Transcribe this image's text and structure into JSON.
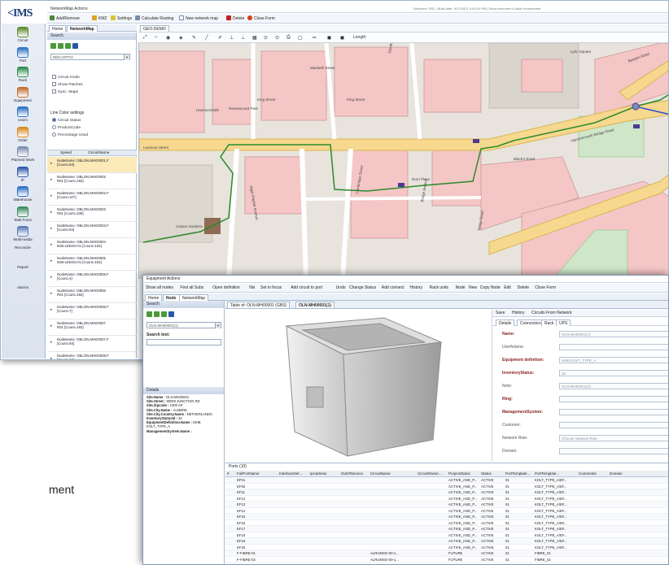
{
  "app": {
    "logo_text": "IMS",
    "menu_title": "NetworkMap Actions",
    "status_right": "Welcome: RSL   |   Build date: 9/17/2021 9:40:19 PM   |   Show welcome to Multi environment",
    "toolbar": [
      "Add/Remove",
      "KMZ",
      "Settings",
      "Calculate Routing",
      "New network map",
      "Delete",
      "Close Form"
    ]
  },
  "sidebar": {
    "items": [
      "Circuit",
      "Port",
      "Rack",
      "Equipment",
      "Users",
      "Order",
      "Planned Work",
      "IP",
      "Warehouse",
      "Task Force",
      "Multi-media",
      "Reconcile",
      "Report",
      "Alarms"
    ]
  },
  "left_tabs": [
    "Home",
    "NetworkMap"
  ],
  "search_panel": {
    "title": "Search",
    "combo_value": "RED-OPTIO",
    "checkboxes": [
      "Circuit mode",
      "Show Patches",
      "Sync. Maps"
    ],
    "line_color_title": "Line Color settings",
    "radios": [
      "Circuit Status",
      "ProductCode",
      "Percentage Used"
    ],
    "columns": [
      "Speed",
      "CircuitName"
    ],
    "items": [
      [
        "NodeName: OBLON.MHO0001.F",
        "[Count=84]"
      ],
      [
        "NodeName: OBLON.MHO0002",
        "R01 [Count=192]"
      ],
      [
        "NodeName: OBLON.MHO0002.F",
        "[Count=107]"
      ],
      [
        "NodeName: OBLON.MHO0003",
        "R01 [Count=108]"
      ],
      [
        "NodeName: OBLON.MHO0003.F",
        "[Count=84]"
      ],
      [
        "NodeName: OBLON.MHO0004",
        "M25-LEEDS-01 [Count=192]"
      ],
      [
        "NodeName: OBLON.MHO0005",
        "M25-LEEDS-01 [Count=192]"
      ],
      [
        "NodeName: OBLON.MHO0005.F",
        "[Count=4]"
      ],
      [
        "NodeName: OBLON.MHO0006",
        "R01 [Count=192]"
      ],
      [
        "NodeName: OBLON.MHO0006.F",
        "[Count=7]"
      ],
      [
        "NodeName: OBLON.MHO0007",
        "R01 [Count=192]"
      ],
      [
        "NodeName: OBLON.MHO0007.F",
        "[Count=84]"
      ],
      [
        "NodeName: OBLON.MHO0008.F",
        "[Count=84]"
      ]
    ]
  },
  "map": {
    "tab": "GEO-DEMO",
    "labels": [
      "Lyric Square",
      "King Street",
      "King Street",
      "Beadon Road",
      "Glenthorne Road",
      "Black's Road",
      "Hammersmith Bridge Road",
      "Ravenscourt Park",
      "Hammersmith",
      "Dorn Place",
      "Caxton Gardens",
      "Nigel Playfair Avenue",
      "Bridge Avenue",
      "Cambridge Grove",
      "Leamore Street",
      "Macbeth Street",
      "Weltje Road"
    ],
    "range_label": "Length:"
  },
  "equipment": {
    "title": "Equipment Actions",
    "toolbar": [
      "Show all nodes",
      "Find all Subs",
      "Open definition",
      "Nix",
      "Set in focus",
      "Add circuit to port",
      "Undo",
      "Change Status",
      "Add connect",
      "History",
      "Rack units",
      "Node",
      "New",
      "Copy Node",
      "Edit",
      "Delete",
      "Close Form"
    ],
    "tabs": [
      "Home",
      "Node",
      "NetworkMap"
    ],
    "search_title": "Search",
    "search_text_label": "Search text:",
    "combo_value": "OLN-MH00001(1)",
    "details_title": "Details",
    "details": [
      [
        "Site.Name",
        "OLN-MH00001"
      ],
      [
        "Site.Street",
        "90000 JUNCTION RD"
      ],
      [
        "Site.Zipcode",
        "1000 AP"
      ],
      [
        "Site.City.Name",
        "ALMERE"
      ],
      [
        "Site.City.Country.Name",
        "NETHERLANDS"
      ],
      [
        "InventoryStatusId",
        "32"
      ],
      [
        "EquipmentDefinition.Name",
        "MHB KOLT_TYPE_A"
      ],
      [
        "ManagementSystem.Name",
        ""
      ]
    ],
    "doc_tabs": [
      "Table of: OLN-MH00001 (GBS)",
      "OLN-MH00001(1)"
    ],
    "form_tabs": [
      "Save",
      "History",
      "Circuits From Network"
    ],
    "form_subtabs": [
      "Details",
      "Connectors",
      "Rack",
      "UPS"
    ],
    "fields": [
      {
        "label": "Name:",
        "value": "OLN-MH00001(1)",
        "req": true
      },
      {
        "label": "Userfelame:",
        "value": "",
        "req": false
      },
      {
        "label": "Equipment definition:",
        "value": "MHB KOLT_TYPE_A",
        "req": true
      },
      {
        "label": "InventoryStatus:",
        "value": "32",
        "req": true
      },
      {
        "label": "Note:",
        "value": "OLN-MH00001(1)",
        "req": false
      },
      {
        "label": "Ring:",
        "value": "",
        "req": true
      },
      {
        "label": "ManagementSystem:",
        "value": "",
        "req": true
      },
      {
        "label": "Customer:",
        "value": "",
        "req": false
      },
      {
        "label": "Network Role:",
        "value": "Choose Network Role",
        "req": false
      },
      {
        "label": "Domain:",
        "value": "",
        "req": false
      }
    ],
    "grid_title": "Ports (10)",
    "columns": [
      "#",
      "FullPortName",
      "InterfaceDef...",
      "IpAddress",
      "OutOfService",
      "CircuitName",
      "CircuitOwner...",
      "ProjectStatus",
      "Status",
      "PortTemplate...",
      "PortTemplate...",
      "Comments",
      "Domain"
    ],
    "rows": [
      [
        "",
        "EF01",
        "",
        "",
        "",
        "",
        "",
        "ACTIVE_AND_P...",
        "ACTIVE",
        "01",
        "KOLT_TYPE_A/EF...",
        "",
        ""
      ],
      [
        "",
        "EF02",
        "",
        "",
        "",
        "",
        "",
        "ACTIVE_AND_P...",
        "ACTIVE",
        "01",
        "KOLT_TYPE_A/EF...",
        "",
        ""
      ],
      [
        "",
        "EF11",
        "",
        "",
        "",
        "",
        "",
        "ACTIVE_AND_P...",
        "ACTIVE",
        "01",
        "KOLT_TYPE_A/EF...",
        "",
        ""
      ],
      [
        "",
        "EF12",
        "",
        "",
        "",
        "",
        "",
        "ACTIVE_AND_P...",
        "ACTIVE",
        "01",
        "KOLT_TYPE_A/EF...",
        "",
        ""
      ],
      [
        "",
        "EF13",
        "",
        "",
        "",
        "",
        "",
        "ACTIVE_AND_P...",
        "ACTIVE",
        "01",
        "KOLT_TYPE_A/EF...",
        "",
        ""
      ],
      [
        "",
        "EF14",
        "",
        "",
        "",
        "",
        "",
        "ACTIVE_AND_P...",
        "ACTIVE",
        "01",
        "KOLT_TYPE_A/EF...",
        "",
        ""
      ],
      [
        "",
        "EF15",
        "",
        "",
        "",
        "",
        "",
        "ACTIVE_AND_P...",
        "ACTIVE",
        "01",
        "KOLT_TYPE_A/EF...",
        "",
        ""
      ],
      [
        "",
        "EF16",
        "",
        "",
        "",
        "",
        "",
        "ACTIVE_AND_P...",
        "ACTIVE",
        "01",
        "KOLT_TYPE_A/EF...",
        "",
        ""
      ],
      [
        "",
        "EF17",
        "",
        "",
        "",
        "",
        "",
        "ACTIVE_AND_P...",
        "ACTIVE",
        "01",
        "KOLT_TYPE_A/EF...",
        "",
        ""
      ],
      [
        "",
        "EF18",
        "",
        "",
        "",
        "",
        "",
        "ACTIVE_AND_P...",
        "ACTIVE",
        "01",
        "KOLT_TYPE_A/EF...",
        "",
        ""
      ],
      [
        "",
        "EF19",
        "",
        "",
        "",
        "",
        "",
        "ACTIVE_AND_P...",
        "ACTIVE",
        "01",
        "KOLT_TYPE_A/EF...",
        "",
        ""
      ],
      [
        "",
        "EF20",
        "",
        "",
        "",
        "",
        "",
        "ACTIVE_AND_P...",
        "ACTIVE",
        "01",
        "KOLT_TYPE_A/EF...",
        "",
        ""
      ],
      [
        "",
        "F-FIBRE-01",
        "",
        "",
        "",
        "ALRUMSO-00-1...",
        "",
        "FUTURE",
        "ACTIVE",
        "01",
        "FIBRE_01",
        "",
        ""
      ],
      [
        "",
        "F-FIBRE-02",
        "",
        "",
        "",
        "ALRUMSO-00-1...",
        "",
        "FUTURE",
        "ACTIVE",
        "01",
        "FIBRE_02",
        "",
        ""
      ]
    ]
  },
  "page_caption": "ment",
  "colors": {
    "accent": "#1b3f78",
    "route": "#2a8a2a",
    "selected_row": "#fbe9b7"
  }
}
